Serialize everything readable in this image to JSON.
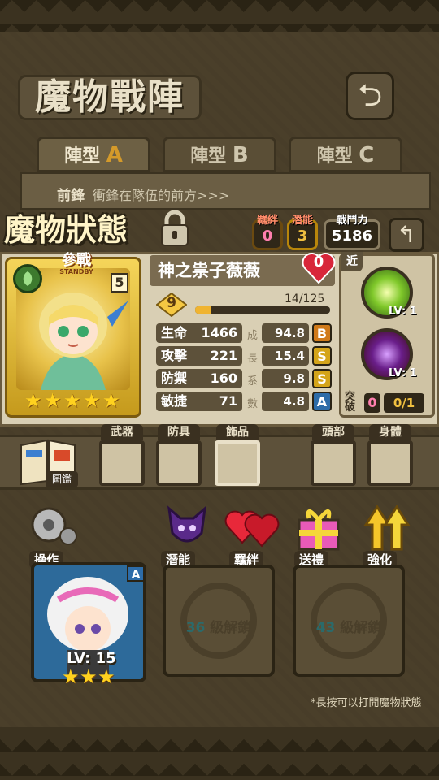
{
  "screen_title": "魔物戰陣",
  "tabs": [
    {
      "label": "陣型",
      "letter": "A"
    },
    {
      "label": "陣型",
      "letter": "B"
    },
    {
      "label": "陣型",
      "letter": "C"
    }
  ],
  "vanguard": {
    "label": "前鋒",
    "description": "衝鋒在隊伍的前方>>>"
  },
  "status_title": "魔物狀態",
  "top_stats": {
    "bond": {
      "label": "羈絆",
      "value": "0"
    },
    "potential": {
      "label": "潛能",
      "value": "3"
    },
    "power": {
      "label": "戰鬥力",
      "value": "5186"
    }
  },
  "monster": {
    "name": "神之祟子薇薇",
    "standby_label": "參戰",
    "standby_sub": "STANDBY",
    "cost": "5",
    "heart_count": "0",
    "level": "9",
    "exp": "14/125",
    "exp_fraction": 0.112,
    "star_count": 5,
    "stats": [
      {
        "label": "生命",
        "value": "1466",
        "growth": "94.8",
        "grade": "B"
      },
      {
        "label": "攻擊",
        "value": "221",
        "growth": "15.4",
        "grade": "S"
      },
      {
        "label": "防禦",
        "value": "160",
        "growth": "9.8",
        "grade": "S"
      },
      {
        "label": "敏捷",
        "value": "71",
        "growth": "4.8",
        "grade": "A"
      }
    ],
    "growth_label_chars": [
      "成",
      "長",
      "系",
      "數"
    ]
  },
  "skills": {
    "range_tag": "近",
    "items": [
      {
        "name": "green-light-skill-icon",
        "level": "LV: 1"
      },
      {
        "name": "dark-slash-skill-icon",
        "level": "LV: 1"
      }
    ],
    "breakthrough_label": "突破",
    "breakthrough_value": "0",
    "breakthrough_max": "0/1"
  },
  "equipment": {
    "book_label": "圖鑑",
    "slots": [
      "武器",
      "防具",
      "飾品",
      "頭部",
      "身體"
    ]
  },
  "actions": [
    {
      "label": "操作",
      "icon": "gear-icon"
    },
    {
      "label": "潛能",
      "icon": "demon-icon"
    },
    {
      "label": "羈絆",
      "icon": "hearts-icon"
    },
    {
      "label": "送禮",
      "icon": "gift-icon"
    },
    {
      "label": "強化",
      "icon": "upgrade-arrows-icon"
    }
  ],
  "team_slots": [
    {
      "type": "monster",
      "level": "LV: 15",
      "stars": 3,
      "grade": "A"
    },
    {
      "type": "locked",
      "level_req": "36",
      "text": "級解鎖"
    },
    {
      "type": "locked",
      "level_req": "43",
      "text": "級解鎖"
    }
  ],
  "hint": "*長按可以打開魔物狀態",
  "colors": {
    "gold": "#f0b431",
    "grade_b": "#d07a1a",
    "grade_s": "#d4a419",
    "grade_a": "#2d6ca8",
    "panel": "#d9cfb4"
  }
}
